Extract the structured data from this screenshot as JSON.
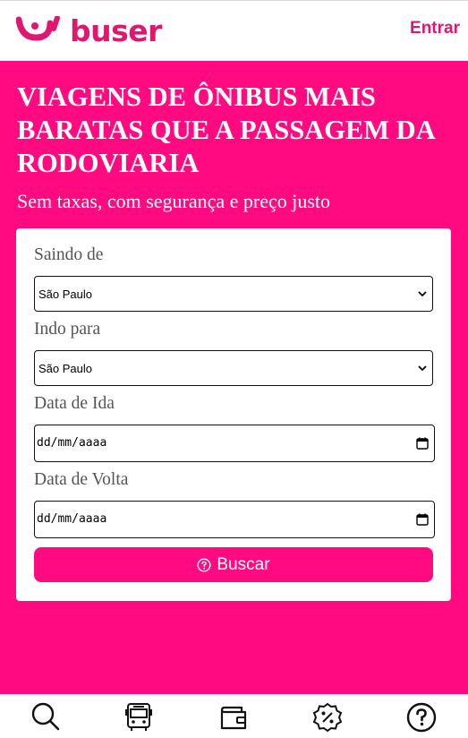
{
  "header": {
    "brand": "buser",
    "login_label": "Entrar"
  },
  "hero": {
    "title": "VIAGENS DE ÔNIBUS MAIS BARATAS QUE A PASSAGEM DA RODOVIARIA",
    "subtitle": "Sem taxas, com segurança e preço justo"
  },
  "form": {
    "origin_label": "Saindo de",
    "origin_value": "São Paulo",
    "destination_label": "Indo para",
    "destination_value": "São Paulo",
    "departure_label": "Data de Ida",
    "departure_placeholder": "dd/mm/aaaa",
    "return_label": "Data de Volta",
    "return_placeholder": "dd/mm/aaaa",
    "search_label": "Buscar"
  },
  "bottom_nav": {
    "items": [
      {
        "icon": "search-icon"
      },
      {
        "icon": "bus-icon"
      },
      {
        "icon": "wallet-icon"
      },
      {
        "icon": "discount-badge-icon"
      },
      {
        "icon": "help-icon"
      }
    ]
  },
  "colors": {
    "brand_pink": "#ff0a80",
    "logo_pink": "#e0176f"
  }
}
